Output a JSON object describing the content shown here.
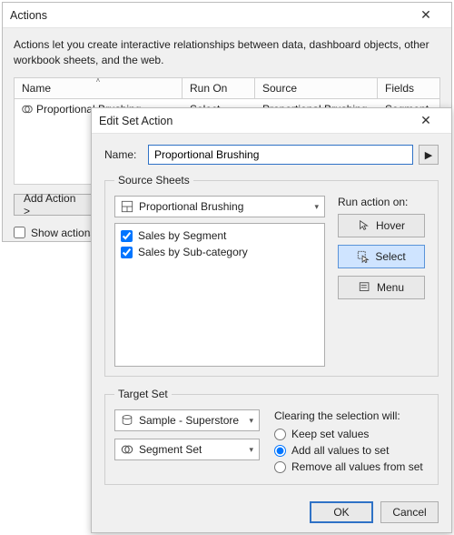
{
  "actions_window": {
    "title": "Actions",
    "intro": "Actions let you create interactive relationships between data, dashboard objects, other workbook sheets, and the web.",
    "columns": {
      "name": "Name",
      "run_on": "Run On",
      "source": "Source",
      "fields": "Fields"
    },
    "rows": [
      {
        "name": "Proportional Brushing",
        "run_on": "Select",
        "source": "Proportional Brushing",
        "fields": "Segment Set"
      }
    ],
    "add_action_label": "Add Action >",
    "show_actions_label": "Show actions for"
  },
  "edit_window": {
    "title": "Edit Set Action",
    "name_label": "Name:",
    "name_value": "Proportional Brushing",
    "source_sheets_legend": "Source Sheets",
    "source_dropdown": "Proportional Brushing",
    "sheets": [
      {
        "label": "Sales by Segment",
        "checked": true
      },
      {
        "label": "Sales by Sub-category",
        "checked": true
      }
    ],
    "run_label": "Run action on:",
    "run_hover": "Hover",
    "run_select": "Select",
    "run_menu": "Menu",
    "target_set_legend": "Target Set",
    "target_source": "Sample - Superstore",
    "target_set": "Segment Set",
    "clearing_label": "Clearing the selection will:",
    "radio_keep": "Keep set values",
    "radio_add": "Add all values to set",
    "radio_remove": "Remove all values from set",
    "ok": "OK",
    "cancel": "Cancel"
  }
}
